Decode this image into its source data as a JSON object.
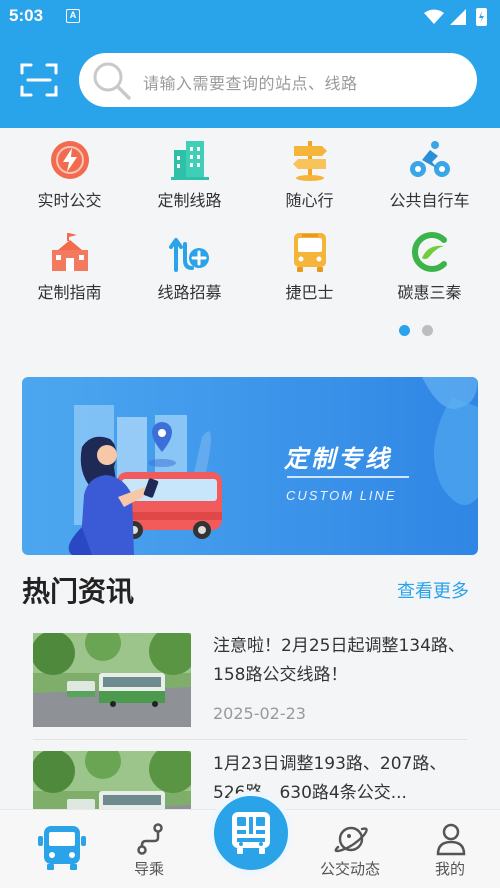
{
  "status_bar": {
    "time": "5:03",
    "notification_badge": "A"
  },
  "search": {
    "placeholder": "请输入需要查询的站点、线路"
  },
  "quick_menu": [
    {
      "label": "实时公交",
      "icon": "lightning-icon"
    },
    {
      "label": "定制线路",
      "icon": "building-icon"
    },
    {
      "label": "随心行",
      "icon": "signpost-icon"
    },
    {
      "label": "公共自行车",
      "icon": "cyclist-icon"
    },
    {
      "label": "定制指南",
      "icon": "school-icon"
    },
    {
      "label": "线路招募",
      "icon": "route-add-icon"
    },
    {
      "label": "捷巴士",
      "icon": "bus-icon"
    },
    {
      "label": "碳惠三秦",
      "icon": "leaf-logo-icon"
    }
  ],
  "pager": {
    "active_index": 0,
    "total": 2
  },
  "banner": {
    "title": "定制专线",
    "subtitle": "CUSTOM LINE"
  },
  "news": {
    "heading": "热门资讯",
    "more_label": "查看更多",
    "items": [
      {
        "text": " 注意啦！2月25日起调整134路、158路公交线路！",
        "date": "2025-02-23"
      },
      {
        "text": "1月23日调整193路、207路、526路、630路4条公交...",
        "date": ""
      }
    ]
  },
  "tabbar": {
    "tabs": [
      {
        "label": "",
        "icon": "bus-icon",
        "active": true
      },
      {
        "label": "导乘",
        "icon": "route-icon"
      },
      {
        "label": "公交动态",
        "icon": "planet-icon"
      },
      {
        "label": "我的",
        "icon": "user-icon"
      }
    ],
    "center": {
      "icon": "qr-bus-icon"
    }
  },
  "colors": {
    "primary": "#29a3ea",
    "accent_red": "#f26b4f",
    "accent_yellow": "#f5b43a",
    "accent_green": "#2fc0a8"
  }
}
